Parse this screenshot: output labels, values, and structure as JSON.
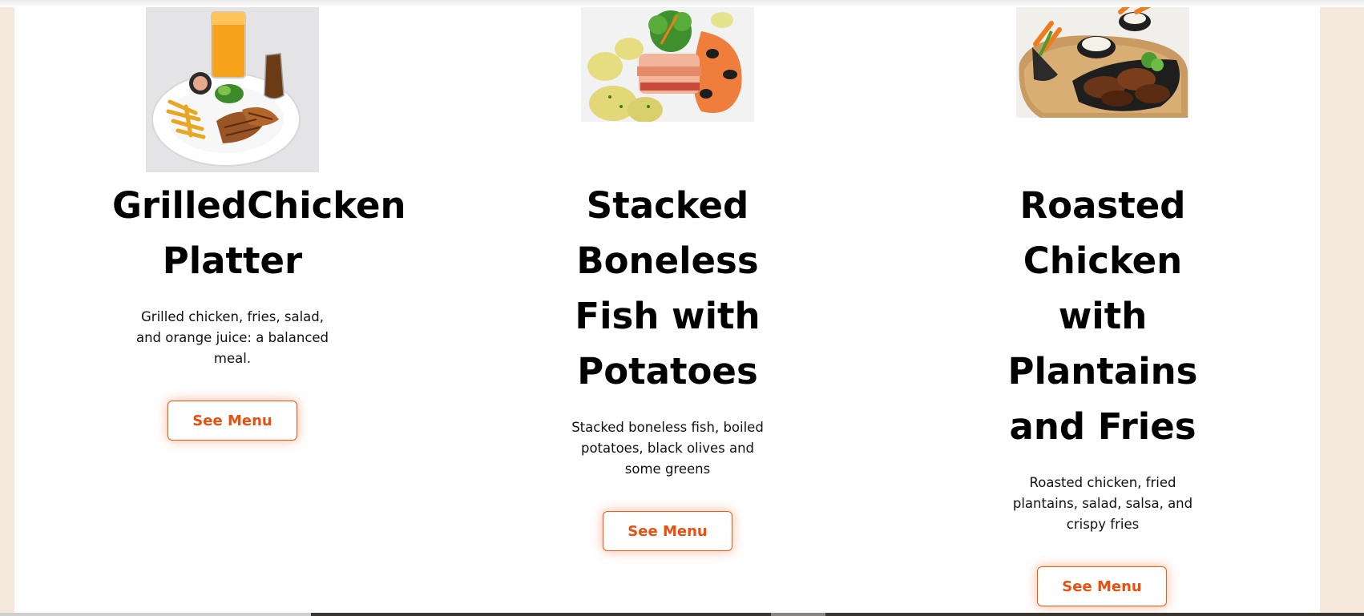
{
  "colors": {
    "page_background": "#f4e9dc",
    "content_background": "#ffffff",
    "button_accent": "#ec4f0c"
  },
  "cards": [
    {
      "image_alt": "Grilled chicken platter photo",
      "title": "GrilledChicken Platter",
      "description": "Grilled chicken, fries, salad, and orange juice: a balanced meal.",
      "button_label": "See Menu"
    },
    {
      "image_alt": "Stacked boneless fish photo",
      "title": "Stacked Boneless Fish with Potatoes",
      "description": "Stacked boneless fish, boiled potatoes, black olives and some greens",
      "button_label": "See Menu"
    },
    {
      "image_alt": "Roasted chicken photo",
      "title": "Roasted Chicken with Plantains and Fries",
      "description": "Roasted chicken, fried plantains, salad, salsa, and crispy fries",
      "button_label": "See Menu"
    }
  ]
}
